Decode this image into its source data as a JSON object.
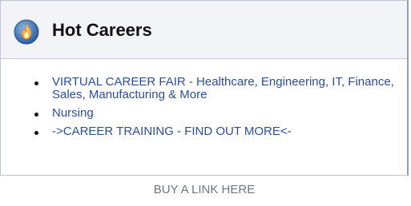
{
  "widget": {
    "title": "Hot Careers",
    "icon": "fire-icon",
    "links": [
      {
        "label": "VIRTUAL CAREER FAIR - Healthcare, Engineering, IT, Finance, Sales, Manufacturing & More"
      },
      {
        "label": "Nursing"
      },
      {
        "label": "->CAREER TRAINING - FIND OUT MORE<-"
      }
    ]
  },
  "footer": {
    "buy_link": "BUY A LINK HERE"
  },
  "colors": {
    "link": "#2a4e9a",
    "title": "#111111",
    "header_bg": "#f2f4f7",
    "icon_bg": "#3f6fb3",
    "flame": "#f5a623",
    "footer_text": "#6b7787"
  }
}
